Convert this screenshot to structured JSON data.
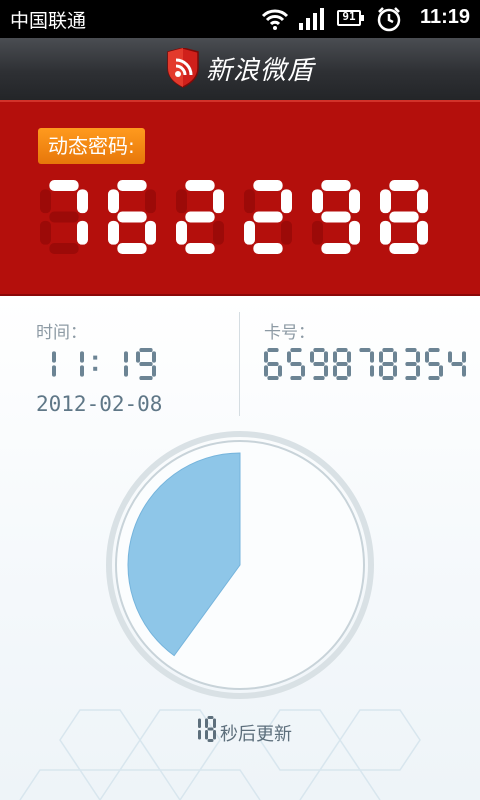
{
  "status_bar": {
    "carrier": "中国联通",
    "battery_level": "91",
    "time": "11:19",
    "icons": [
      "wifi-icon",
      "signal-icon",
      "battery-icon",
      "alarm-icon"
    ]
  },
  "app": {
    "title": "新浪微盾",
    "logo_icon": "weibo-shield-logo"
  },
  "code": {
    "label": "动态密码:",
    "value": "762298"
  },
  "info": {
    "time_label": "时间：",
    "time_value": "11:19",
    "date_value": "2012-02-08",
    "card_label": "卡号：",
    "card_value": "659878354"
  },
  "countdown": {
    "seconds": "18",
    "suffix": "秒后更新",
    "progress_fraction": 0.4
  },
  "colors": {
    "panel_red": "#b40f0c",
    "label_orange": "#f08813",
    "digit_blue": "#6c8494",
    "timer_fill": "#8ec6e8"
  }
}
